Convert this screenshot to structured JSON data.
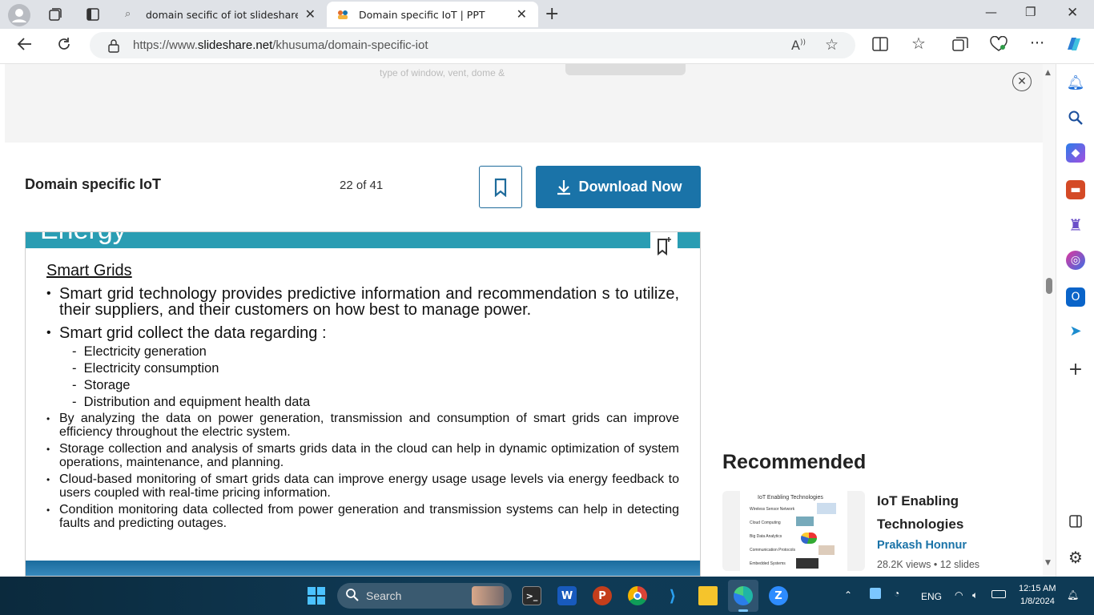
{
  "browser": {
    "tabs": [
      {
        "title": "domain secific of iot slideshare p",
        "active": false
      },
      {
        "title": "Domain specific IoT | PPT",
        "active": true
      }
    ],
    "url_prefix": "https://www.",
    "url_domain": "slideshare.net",
    "url_path": "/khusuma/domain-specific-iot",
    "ad_text": "type of window, vent, dome &"
  },
  "viewer": {
    "title": "Domain specific IoT",
    "counter": "22 of 41",
    "download_label": "Download Now"
  },
  "slide": {
    "heading_partial": "Energy",
    "subtitle": "Smart Grids",
    "bullets_large": [
      "Smart grid technology provides predictive information and recommendation s to utilize, their suppliers, and their customers on how best to manage power.",
      "Smart grid collect the data regarding :"
    ],
    "sub_items": [
      "Electricity generation",
      "Electricity consumption",
      "Storage",
      "Distribution and equipment health data"
    ],
    "bullets_small": [
      "By analyzing the data on power generation, transmission and consumption of smart grids can improve efficiency throughout the electric system.",
      "Storage collection and analysis of smarts grids data in the cloud can help in dynamic optimization of system operations, maintenance, and planning.",
      "Cloud-based monitoring of smart grids data can improve energy usage usage levels via energy feedback to users coupled with real-time pricing information.",
      "Condition monitoring data collected from power generation and transmission systems can help in detecting faults and predicting outages."
    ]
  },
  "recommended": {
    "heading": "Recommended",
    "item": {
      "title": "IoT Enabling Technologies",
      "author": "Prakash Honnur",
      "meta": "28.2K views  •  12 slides",
      "thumb_title": "IoT Enabling Technologies",
      "thumb_items": [
        "Wireless Sensor Network",
        "Cloud Computing",
        "Big Data Analytics",
        "Communication Protocols",
        "Embedded Systems"
      ]
    }
  },
  "taskbar": {
    "search_placeholder": "Search",
    "lang": "ENG",
    "time": "12:15 AM",
    "date": "1/8/2024"
  },
  "colors": {
    "accent": "#1a73a8",
    "slide_bar": "#2a9db3"
  }
}
